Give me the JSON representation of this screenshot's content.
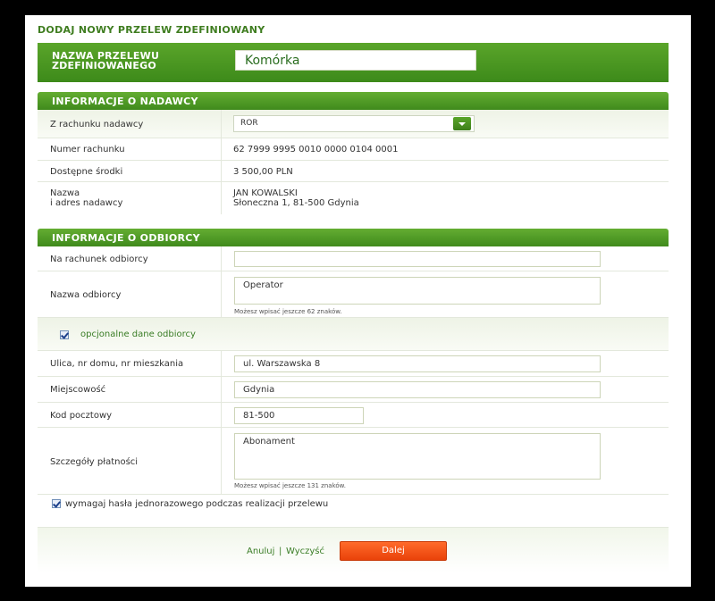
{
  "page": {
    "title": "DODAJ NOWY PRZELEW ZDEFINIOWANY",
    "name_label": "NAZWA PRZELEWU ZDEFINIOWANEGO",
    "name_value": "Komórka"
  },
  "sender": {
    "header": "INFORMACJE O NADAWCY",
    "account_label": "Z rachunku nadawcy",
    "account_selected": "ROR",
    "number_label": "Numer rachunku",
    "number_value": "62 7999 9995 0010 0000 0104 0001",
    "funds_label": "Dostępne środki",
    "funds_value": "3 500,00 PLN",
    "address_label_1": "Nazwa",
    "address_label_2": "i adres nadawcy",
    "address_line_1": "JAN KOWALSKI",
    "address_line_2": "Słoneczna 1, 81-500 Gdynia"
  },
  "recipient": {
    "header": "INFORMACJE O ODBIORCY",
    "account_label": "Na rachunek odbiorcy",
    "account_value": "",
    "name_label": "Nazwa odbiorcy",
    "name_value": "Operator",
    "name_hint": "Możesz wpisać jeszcze 62 znaków.",
    "optional_label": "opcjonalne dane odbiorcy",
    "street_label": "Ulica, nr domu, nr mieszkania",
    "street_value": "ul. Warszawska 8",
    "city_label": "Miejscowość",
    "city_value": "Gdynia",
    "postal_label": "Kod pocztowy",
    "postal_value": "81-500",
    "details_label": "Szczegóły płatności",
    "details_value": "Abonament",
    "details_hint": "Możesz wpisać jeszcze 131 znaków.",
    "otp_label": "wymagaj hasła jednorazowego podczas realizacji przelewu"
  },
  "footer": {
    "cancel": "Anuluj",
    "separator": "|",
    "clear": "Wyczyść",
    "next": "Dalej"
  },
  "colors": {
    "brand_green": "#3d8a1a",
    "accent_orange": "#e9420a"
  }
}
